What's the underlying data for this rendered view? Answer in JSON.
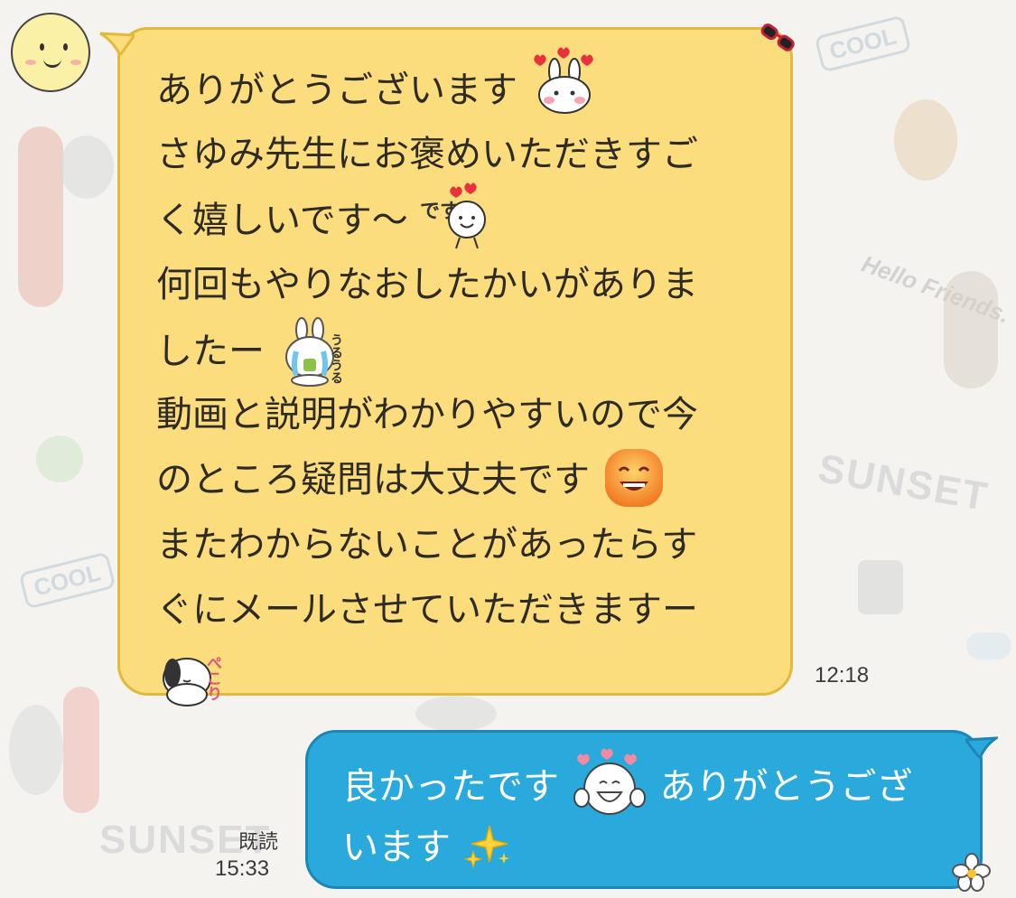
{
  "chat": {
    "incoming": {
      "lines": [
        "ありがとうございます",
        "さゆみ先生にお褒めいただきすご",
        "く嬉しいです〜",
        "何回もやりなおしたかいがありま",
        "したー",
        "動画と説明がわかりやすいので今",
        "のところ疑問は大丈夫です",
        "またわからないことがあったらす",
        "ぐにメールさせていただきますー"
      ],
      "sticker_desu_text": "です",
      "sticker_uruuru_text": "うるうる",
      "sticker_pekori_text": "ぺこり",
      "time": "12:18"
    },
    "outgoing": {
      "lines": [
        "良かったです",
        "ありがとうござ",
        "います"
      ],
      "read_status": "既読",
      "time": "15:33"
    }
  },
  "wallpaper": {
    "words": [
      "SUNSET",
      "SUNSET",
      "COOL",
      "COOL",
      "Hello Friends."
    ]
  },
  "colors": {
    "incoming_bubble": "#fbdd7e",
    "incoming_border": "#e2b93b",
    "outgoing_bubble": "#2aa9dc",
    "outgoing_border": "#1d86b5",
    "background": "#f4f3f0"
  },
  "icons": [
    "avatar-smiley-icon",
    "bunny-hearts-icon",
    "smiley-desu-icon",
    "crying-bunny-icon",
    "grinning-face-icon",
    "snoopy-bow-icon",
    "happy-face-hearts-icon",
    "sparkles-icon",
    "sunglasses-icon",
    "flower-icon"
  ]
}
